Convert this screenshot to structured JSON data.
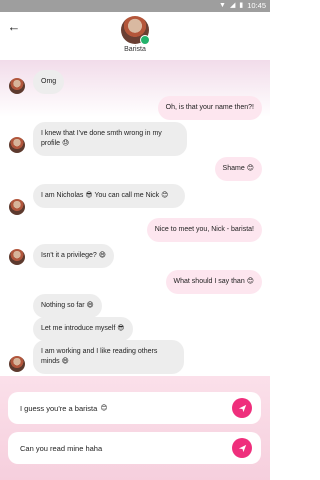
{
  "status_bar": {
    "time": "10:45"
  },
  "header": {
    "contact_name": "Barista"
  },
  "messages": [
    {
      "from": "contact",
      "text": "Omg",
      "emoji": ""
    },
    {
      "from": "me",
      "text": "Oh, is that your name then?!",
      "emoji": ""
    },
    {
      "from": "contact",
      "text": "I knew that I've done smth wrong in my profile",
      "emoji": "😓"
    },
    {
      "from": "me",
      "text": "Shame",
      "emoji": "😊"
    },
    {
      "from": "contact",
      "text": "I am Nicholas 😎 You can call me Nick",
      "emoji": "😊"
    },
    {
      "from": "me",
      "text": "Nice to meet you, Nick - barista!",
      "emoji": ""
    },
    {
      "from": "contact",
      "text": "Isn't it a privilege?",
      "emoji": "😄"
    },
    {
      "from": "me",
      "text": "What should I say than",
      "emoji": "😊"
    },
    {
      "from": "contact",
      "text": "Nothing so far",
      "emoji": "😄"
    },
    {
      "from": "contact",
      "text": "Let me introduce myself",
      "emoji": "😎"
    },
    {
      "from": "contact",
      "text": "I am working and I like reading others minds",
      "emoji": "😄"
    }
  ],
  "replies": [
    {
      "text": "I guess you're a barista",
      "emoji": "😊"
    },
    {
      "text": "Can you read mine haha",
      "emoji": ""
    }
  ],
  "colors": {
    "accent": "#ef2f7c",
    "incoming_bubble": "#ededed",
    "outgoing_bubble": "#fde6ef",
    "online": "#22b26b"
  },
  "icons": {
    "back": "arrow-left-icon",
    "send": "send-icon"
  }
}
